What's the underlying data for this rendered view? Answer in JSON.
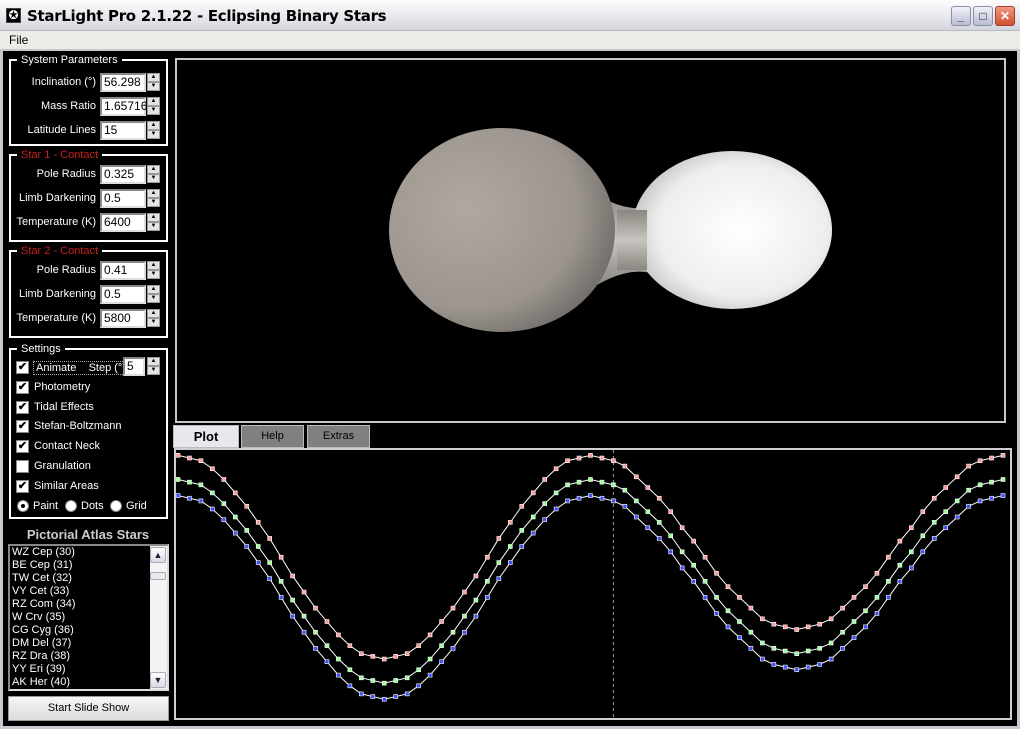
{
  "window": {
    "title": "StarLight Pro 2.1.22 - Eclipsing Binary Stars",
    "icon": "starlight-app-icon",
    "minimize": "_",
    "maximize": "□",
    "close": "✕"
  },
  "menu": {
    "file": "File"
  },
  "system": {
    "title": "System Parameters",
    "fields": [
      {
        "label": "Inclination (°)",
        "value": "56.298"
      },
      {
        "label": "Mass Ratio",
        "value": "1.65716"
      },
      {
        "label": "Latitude Lines",
        "value": "15"
      }
    ]
  },
  "star1": {
    "title": "Star 1 - Contact",
    "fields": [
      {
        "label": "Pole Radius",
        "value": "0.325"
      },
      {
        "label": "Limb Darkening",
        "value": "0.5"
      },
      {
        "label": "Temperature (K)",
        "value": "6400"
      }
    ]
  },
  "star2": {
    "title": "Star 2 - Contact",
    "fields": [
      {
        "label": "Pole Radius",
        "value": "0.41"
      },
      {
        "label": "Limb Darkening",
        "value": "0.5"
      },
      {
        "label": "Temperature (K)",
        "value": "5800"
      }
    ]
  },
  "settings": {
    "title": "Settings",
    "animate_label": "Animate    Step (°)",
    "step_value": "5",
    "checks": [
      {
        "label": "Animate",
        "checked": true
      },
      {
        "label": "Photometry",
        "checked": true
      },
      {
        "label": "Tidal Effects",
        "checked": true
      },
      {
        "label": "Stefan-Boltzmann",
        "checked": true
      },
      {
        "label": "Contact Neck",
        "checked": true
      },
      {
        "label": "Granulation",
        "checked": false
      },
      {
        "label": "Similar Areas",
        "checked": true
      }
    ],
    "render_modes": [
      {
        "label": "Paint",
        "selected": true
      },
      {
        "label": "Dots",
        "selected": false
      },
      {
        "label": "Grid",
        "selected": false
      }
    ]
  },
  "atlas": {
    "title": "Pictorial Atlas Stars",
    "items": [
      "WZ Cep (30)",
      "BE Cep (31)",
      "TW Cet (32)",
      "VY Cet (33)",
      "RZ Com (34)",
      "W Crv (35)",
      "CG Cyg (36)",
      "DM Del (37)",
      "RZ Dra (38)",
      "YY Eri (39)",
      "AK Her (40)"
    ],
    "scroll_up": "▲",
    "scroll_down": "▼"
  },
  "slide_show": "Start Slide Show",
  "tabs": [
    {
      "label": "Plot",
      "active": true
    },
    {
      "label": "Help",
      "active": false
    },
    {
      "label": "Extras",
      "active": false
    }
  ],
  "colors": {
    "star1": "#a8a29c",
    "star2": "#f2f2f2",
    "series_red": "#ff9a9a",
    "series_green": "#9aff9a",
    "series_blue": "#4050ff"
  },
  "chart_data": {
    "type": "line",
    "x_step_deg": 5,
    "xlim": [
      0,
      360
    ],
    "ylim": [
      0,
      1
    ],
    "grid": false,
    "current_phase": 190,
    "series": [
      {
        "color": "#ff9a9a",
        "values": [
          0.98,
          0.97,
          0.96,
          0.93,
          0.89,
          0.84,
          0.79,
          0.73,
          0.67,
          0.6,
          0.53,
          0.47,
          0.41,
          0.36,
          0.31,
          0.27,
          0.24,
          0.23,
          0.22,
          0.23,
          0.24,
          0.27,
          0.31,
          0.36,
          0.41,
          0.47,
          0.53,
          0.6,
          0.67,
          0.73,
          0.79,
          0.84,
          0.89,
          0.93,
          0.96,
          0.97,
          0.98,
          0.97,
          0.96,
          0.94,
          0.9,
          0.86,
          0.82,
          0.77,
          0.71,
          0.66,
          0.6,
          0.54,
          0.49,
          0.45,
          0.41,
          0.37,
          0.35,
          0.34,
          0.33,
          0.34,
          0.35,
          0.37,
          0.41,
          0.45,
          0.49,
          0.54,
          0.6,
          0.66,
          0.71,
          0.77,
          0.82,
          0.86,
          0.9,
          0.94,
          0.96,
          0.97,
          0.98
        ]
      },
      {
        "color": "#9aff9a",
        "values": [
          0.89,
          0.88,
          0.87,
          0.84,
          0.8,
          0.75,
          0.7,
          0.64,
          0.58,
          0.51,
          0.44,
          0.38,
          0.32,
          0.27,
          0.22,
          0.18,
          0.15,
          0.14,
          0.13,
          0.14,
          0.15,
          0.18,
          0.22,
          0.27,
          0.32,
          0.38,
          0.44,
          0.51,
          0.58,
          0.64,
          0.7,
          0.75,
          0.8,
          0.84,
          0.87,
          0.88,
          0.89,
          0.88,
          0.87,
          0.85,
          0.81,
          0.77,
          0.73,
          0.68,
          0.62,
          0.57,
          0.51,
          0.45,
          0.4,
          0.36,
          0.32,
          0.28,
          0.26,
          0.25,
          0.24,
          0.25,
          0.26,
          0.28,
          0.32,
          0.36,
          0.4,
          0.45,
          0.51,
          0.57,
          0.62,
          0.68,
          0.73,
          0.77,
          0.81,
          0.85,
          0.87,
          0.88,
          0.89
        ]
      },
      {
        "color": "#4050ff",
        "values": [
          0.83,
          0.82,
          0.81,
          0.78,
          0.74,
          0.69,
          0.64,
          0.58,
          0.52,
          0.45,
          0.38,
          0.32,
          0.26,
          0.21,
          0.16,
          0.12,
          0.09,
          0.08,
          0.07,
          0.08,
          0.09,
          0.12,
          0.16,
          0.21,
          0.26,
          0.32,
          0.38,
          0.45,
          0.52,
          0.58,
          0.64,
          0.69,
          0.74,
          0.78,
          0.81,
          0.82,
          0.83,
          0.82,
          0.81,
          0.79,
          0.75,
          0.71,
          0.67,
          0.62,
          0.56,
          0.51,
          0.45,
          0.39,
          0.34,
          0.3,
          0.26,
          0.22,
          0.2,
          0.19,
          0.18,
          0.19,
          0.2,
          0.22,
          0.26,
          0.3,
          0.34,
          0.39,
          0.45,
          0.51,
          0.56,
          0.62,
          0.67,
          0.71,
          0.75,
          0.79,
          0.81,
          0.82,
          0.83
        ]
      }
    ]
  }
}
